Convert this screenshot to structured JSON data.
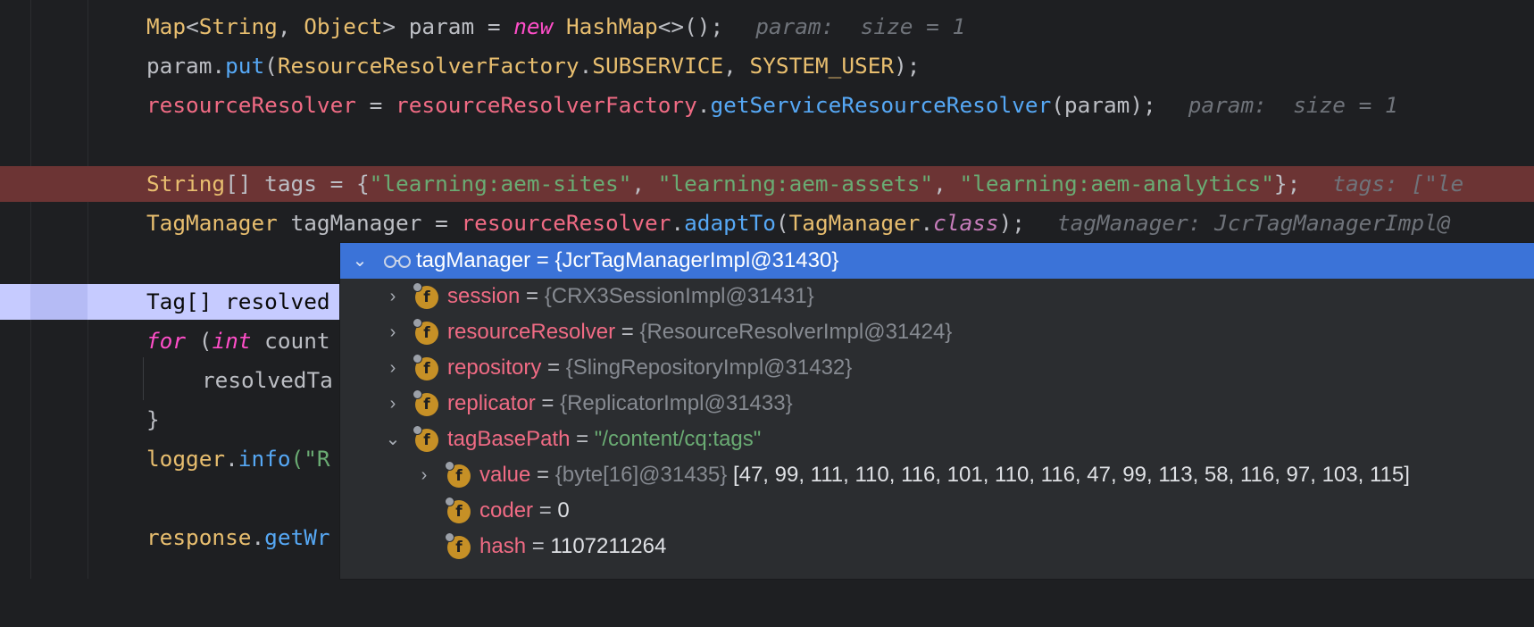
{
  "code": {
    "line1": {
      "t1": "Map",
      "t2": "<",
      "t3": "String",
      "t4": ", ",
      "t5": "Object",
      "t6": "> param = ",
      "t7": "new",
      "t8": " ",
      "t9": "HashMap",
      "t10": "<>();",
      "hint": "param:  size = 1"
    },
    "line2": {
      "t1": "param.",
      "t2": "put",
      "t3": "(",
      "t4": "ResourceResolverFactory",
      "t5": ".",
      "t6": "SUBSERVICE",
      "t7": ", ",
      "t8": "SYSTEM_USER",
      "t9": ");"
    },
    "line3": {
      "t1": "resourceResolver",
      "t2": " = ",
      "t3": "resourceResolverFactory",
      "t4": ".",
      "t5": "getServiceResourceResolver",
      "t6": "(param);",
      "hint": "param:  size = 1"
    },
    "line5": {
      "t1": "String",
      "t2": "[] tags = {",
      "t3": "\"learning:aem-sites\"",
      "t4": ", ",
      "t5": "\"learning:aem-assets\"",
      "t6": ", ",
      "t7": "\"learning:aem-analytics\"",
      "t8": "};",
      "hint": "tags: [\"le"
    },
    "line6": {
      "t1": "TagManager",
      "t2": " tagManager = ",
      "t3": "resourceResolver",
      "t4": ".",
      "t5": "adaptTo",
      "t6": "(",
      "t7": "TagManager",
      "t8": ".",
      "t9": "class",
      "t10": ");",
      "hint": "tagManager: JcrTagManagerImpl@"
    },
    "line8": {
      "t1": "Tag[] resolved"
    },
    "line9": {
      "t1": "for",
      "t2": " (",
      "t3": "int",
      "t4": " count"
    },
    "line10": {
      "t1": "resolvedTa"
    },
    "line11": {
      "t1": "}"
    },
    "line12": {
      "t1": "logger",
      "t2": ".",
      "t3": "info",
      "t4": "(\"R"
    },
    "line14": {
      "t1": "response",
      "t2": ".",
      "t3": "getWr"
    }
  },
  "debug_popup": {
    "root": {
      "name": "tagManager",
      "eq": " = ",
      "value": "{JcrTagManagerImpl@31430}",
      "icon": "watch-glasses-icon"
    },
    "fields": [
      {
        "name": "session",
        "eq": " = ",
        "value": "{CRX3SessionImpl@31431}",
        "badge": "f",
        "expanded": false
      },
      {
        "name": "resourceResolver",
        "eq": " = ",
        "value": "{ResourceResolverImpl@31424}",
        "badge": "f",
        "expanded": false
      },
      {
        "name": "repository",
        "eq": " = ",
        "value": "{SlingRepositoryImpl@31432}",
        "badge": "f",
        "expanded": false
      },
      {
        "name": "replicator",
        "eq": " = ",
        "value": "{ReplicatorImpl@31433}",
        "badge": "f",
        "expanded": false
      },
      {
        "name": "tagBasePath",
        "eq": " = ",
        "value": "\"/content/cq:tags\"",
        "badge": "f",
        "expanded": true
      }
    ],
    "children": [
      {
        "name": "value",
        "eq": " = ",
        "ref": "{byte[16]@31435} ",
        "value": "[47, 99, 111, 110, 116, 101, 110, 116, 47, 99, 113, 58, 116, 97, 103, 115]",
        "badge": "f"
      },
      {
        "name": "coder",
        "eq": " = ",
        "value": "0",
        "badge": "f"
      },
      {
        "name": "hash",
        "eq": " = ",
        "value": "1107211264",
        "badge": "f"
      }
    ]
  },
  "colors": {
    "breakpoint_line": "#6c3434",
    "current_line": "#c6cbff",
    "selected_row": "#3b73d8",
    "field_badge": "#c69026"
  }
}
